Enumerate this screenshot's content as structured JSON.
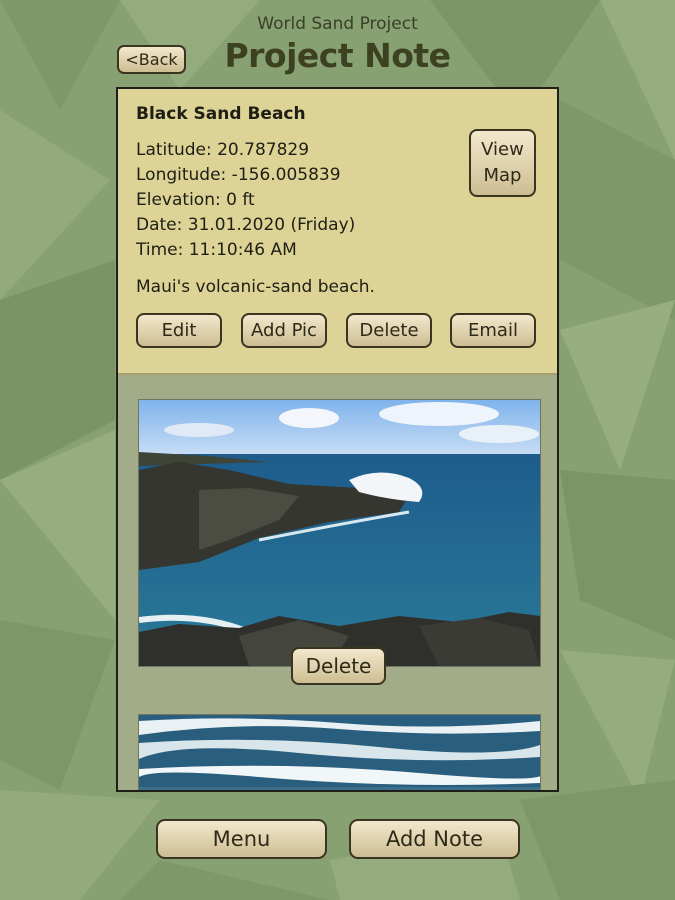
{
  "header": {
    "app_name": "World Sand Project",
    "title": "Project Note",
    "back_label": "<Back"
  },
  "note": {
    "name": "Black Sand Beach",
    "latitude": "Latitude: 20.787829",
    "longitude": "Longitude: -156.005839",
    "elevation": "Elevation: 0 ft",
    "date": "Date: 31.01.2020 (Friday)",
    "time": "Time: 11:10:46 AM",
    "description": "Maui's volcanic-sand beach.",
    "view_map_line1": "View",
    "view_map_line2": "Map",
    "actions": {
      "edit": "Edit",
      "add_pic": "Add Pic",
      "delete": "Delete",
      "email": "Email"
    }
  },
  "photos": {
    "delete_label": "Delete"
  },
  "footer": {
    "menu_label": "Menu",
    "add_note_label": "Add Note"
  },
  "colors": {
    "background": "#88a172",
    "info_panel": "#ddd397",
    "button_top": "#f2e8cc",
    "button_bottom": "#cdbd92",
    "title_text": "#3b4121"
  }
}
